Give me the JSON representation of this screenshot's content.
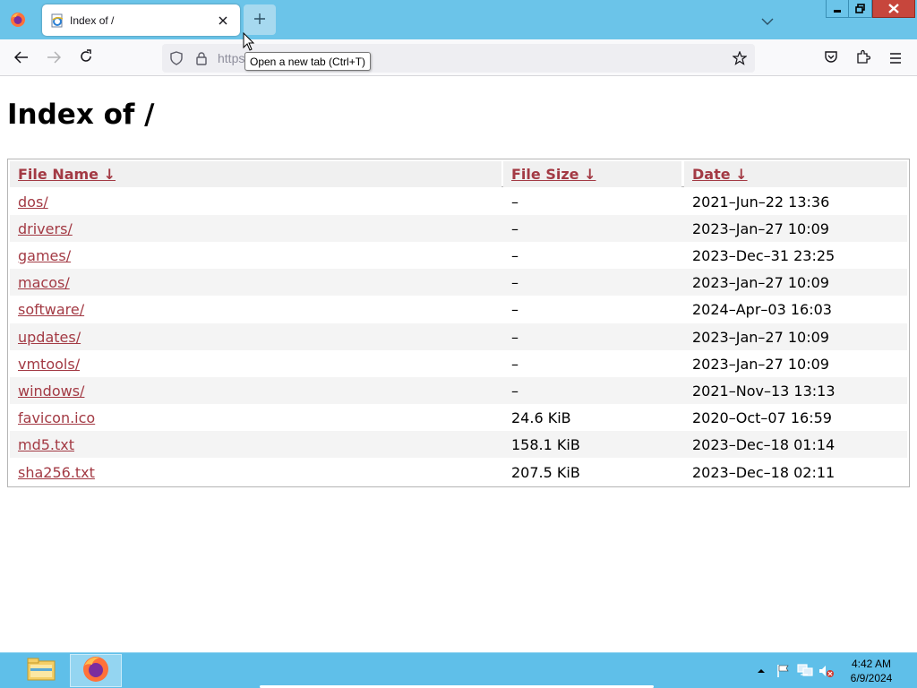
{
  "browser": {
    "tab": {
      "title": "Index of /"
    },
    "url_text": "https:",
    "tooltip": "Open a new tab (Ctrl+T)",
    "icons": {
      "app_menu": "firefox-icon",
      "tab_favicon": "ie-page-icon",
      "tab_close": "close-icon",
      "new_tab": "plus-icon",
      "list_tabs": "chevron-down-icon",
      "back": "back-arrow-icon",
      "forward": "forward-arrow-icon",
      "reload": "reload-icon",
      "tracking": "shield-icon",
      "lock": "lock-icon",
      "bookmark": "star-icon",
      "pocket": "pocket-icon",
      "extensions": "puzzle-icon",
      "menu": "hamburger-menu-icon"
    }
  },
  "page": {
    "title": "Index of /",
    "columns": [
      {
        "label": "File Name ↓"
      },
      {
        "label": "File Size ↓"
      },
      {
        "label": "Date ↓"
      }
    ],
    "rows": [
      {
        "name": "dos/",
        "size": "–",
        "date": "2021–Jun–22 13:36"
      },
      {
        "name": "drivers/",
        "size": "–",
        "date": "2023–Jan–27 10:09"
      },
      {
        "name": "games/",
        "size": "–",
        "date": "2023–Dec–31 23:25"
      },
      {
        "name": "macos/",
        "size": "–",
        "date": "2023–Jan–27 10:09"
      },
      {
        "name": "software/",
        "size": "–",
        "date": "2024–Apr–03 16:03"
      },
      {
        "name": "updates/",
        "size": "–",
        "date": "2023–Jan–27 10:09"
      },
      {
        "name": "vmtools/",
        "size": "–",
        "date": "2023–Jan–27 10:09"
      },
      {
        "name": "windows/",
        "size": "–",
        "date": "2021–Nov–13 13:13"
      },
      {
        "name": "favicon.ico",
        "size": "24.6 KiB",
        "date": "2020–Oct–07 16:59"
      },
      {
        "name": "md5.txt",
        "size": "158.1 KiB",
        "date": "2023–Dec–18 01:14"
      },
      {
        "name": "sha256.txt",
        "size": "207.5 KiB",
        "date": "2023–Dec–18 02:11"
      }
    ],
    "link_color": "#a33a44"
  },
  "taskbar": {
    "time": "4:42 AM",
    "date": "6/9/2024",
    "icons": [
      "file-explorer-icon",
      "firefox-icon",
      "tray-overflow-icon",
      "action-center-flag-icon",
      "network-icon",
      "speaker-muted-icon"
    ]
  },
  "colors": {
    "tabstrip": "#6bc4e9",
    "taskbar": "#5fbfe9",
    "close_button": "#c7463c"
  }
}
